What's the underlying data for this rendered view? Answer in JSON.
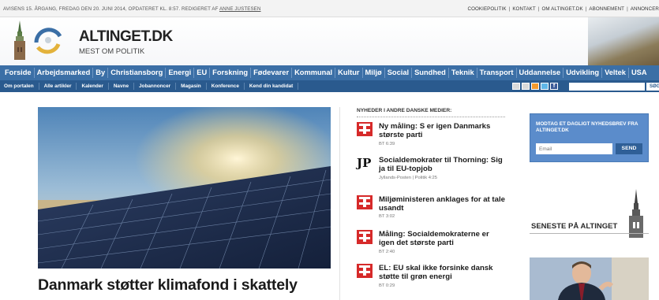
{
  "topbar": {
    "dateline": "AVISENS 15. ÅRGANG, FREDAG DEN 20. JUNI 2014, OPDATERET KL. 8:57. REDIGERET AF",
    "editor": "ANNE JUSTESEN",
    "links": [
      "COOKIEPOLITIK",
      "KONTAKT",
      "OM ALTINGET.DK",
      "ABONNEMENT",
      "ANNONCER"
    ]
  },
  "header": {
    "brand": "ALTINGET.DK",
    "tagline": "MEST OM POLITIK"
  },
  "sections": [
    "Forside",
    "Arbejdsmarked",
    "By",
    "Christiansborg",
    "Energi",
    "EU",
    "Forskning",
    "Fødevarer",
    "Kommunal",
    "Kultur",
    "Miljø",
    "Social",
    "Sundhed",
    "Teknik",
    "Transport",
    "Uddannelse",
    "Udvikling",
    "Veltek",
    "USA"
  ],
  "subnav": {
    "links": [
      "Om portalen",
      "Alle artikler",
      "Kalender",
      "Navne",
      "Jobannoncer",
      "Magasin",
      "Konference",
      "Kend din kandidat"
    ],
    "search_button": "SØG"
  },
  "main_story": {
    "headline": "Danmark støtter klimafond i skattely"
  },
  "news_column": {
    "heading": "NYHEDER I ANDRE DANSKE MEDIER:",
    "items": [
      {
        "source": "BT",
        "title": "Ny måling: S er igen Danmarks største parti",
        "meta": "BT 6:39"
      },
      {
        "source": "JP",
        "title": "Socialdemokrater til Thorning: Sig ja til EU-topjob",
        "meta": "Jyllands-Posten | Politik 4:25"
      },
      {
        "source": "BT",
        "title": "Miljøministeren anklages for at tale usandt",
        "meta": "BT 3:02"
      },
      {
        "source": "BT",
        "title": "Måling: Socialdemokraterne er igen det største parti",
        "meta": "BT 2:40"
      },
      {
        "source": "BT",
        "title": "EL: EU skal ikke forsinke dansk støtte til grøn energi",
        "meta": "BT 0:29"
      }
    ]
  },
  "newsletter": {
    "title": "MODTAG ET DAGLIGT NYHEDSBREV FRA ALTINGET.DK",
    "placeholder": "Email",
    "button": "SEND"
  },
  "latest": {
    "title": "SENESTE PÅ ALTINGET"
  },
  "colors": {
    "sections_bg": "#3b6fa6",
    "subnav_bg": "#2a5a8e",
    "newsletter_bg": "#5b8ccb",
    "bt_red": "#d62a2a"
  }
}
